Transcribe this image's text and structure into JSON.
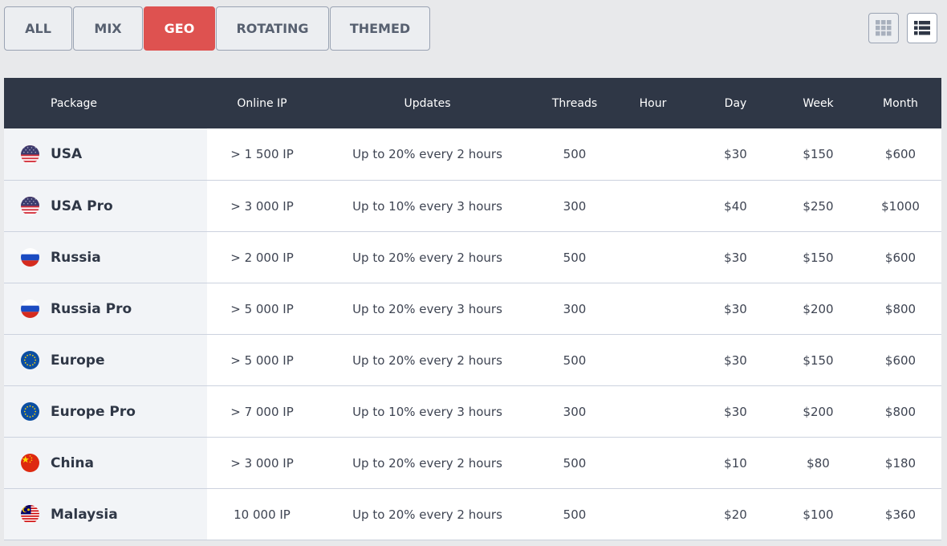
{
  "tabs": [
    {
      "label": "ALL",
      "active": false
    },
    {
      "label": "MIX",
      "active": false
    },
    {
      "label": "GEO",
      "active": true
    },
    {
      "label": "ROTATING",
      "active": false
    },
    {
      "label": "THEMED",
      "active": false
    }
  ],
  "view_toggle": {
    "grid_icon": "grid-icon",
    "list_icon": "list-icon",
    "selected": "list"
  },
  "table": {
    "headers": {
      "package": "Package",
      "online_ip": "Online IP",
      "updates": "Updates",
      "threads": "Threads",
      "hour": "Hour",
      "day": "Day",
      "week": "Week",
      "month": "Month"
    },
    "rows": [
      {
        "flag": "usa-flag-icon",
        "package": "USA",
        "online_ip": "> 1 500 IP",
        "updates": "Up to 20% every 2 hours",
        "threads": "500",
        "hour": "",
        "day": "$30",
        "week": "$150",
        "month": "$600"
      },
      {
        "flag": "usa-flag-icon",
        "package": "USA Pro",
        "online_ip": "> 3 000 IP",
        "updates": "Up to 10% every 3 hours",
        "threads": "300",
        "hour": "",
        "day": "$40",
        "week": "$250",
        "month": "$1000"
      },
      {
        "flag": "russia-flag-icon",
        "package": "Russia",
        "online_ip": "> 2 000 IP",
        "updates": "Up to 20% every 2 hours",
        "threads": "500",
        "hour": "",
        "day": "$30",
        "week": "$150",
        "month": "$600"
      },
      {
        "flag": "russia-flag-icon",
        "package": "Russia Pro",
        "online_ip": "> 5 000 IP",
        "updates": "Up to 20% every 3 hours",
        "threads": "300",
        "hour": "",
        "day": "$30",
        "week": "$200",
        "month": "$800"
      },
      {
        "flag": "eu-flag-icon",
        "package": "Europe",
        "online_ip": "> 5 000 IP",
        "updates": "Up to 20% every 2 hours",
        "threads": "500",
        "hour": "",
        "day": "$30",
        "week": "$150",
        "month": "$600"
      },
      {
        "flag": "eu-flag-icon",
        "package": "Europe Pro",
        "online_ip": "> 7 000 IP",
        "updates": "Up to 10% every 3 hours",
        "threads": "300",
        "hour": "",
        "day": "$30",
        "week": "$200",
        "month": "$800"
      },
      {
        "flag": "china-flag-icon",
        "package": "China",
        "online_ip": "> 3 000 IP",
        "updates": "Up to 20% every 2 hours",
        "threads": "500",
        "hour": "",
        "day": "$10",
        "week": "$80",
        "month": "$180"
      },
      {
        "flag": "malaysia-flag-icon",
        "package": "Malaysia",
        "online_ip": "10 000 IP",
        "updates": "Up to 20% every 2 hours",
        "threads": "500",
        "hour": "",
        "day": "$20",
        "week": "$100",
        "month": "$360"
      }
    ]
  },
  "colors": {
    "accent": "#de5250",
    "header_bg": "#2f3746",
    "page_bg": "#e8e9eb"
  }
}
